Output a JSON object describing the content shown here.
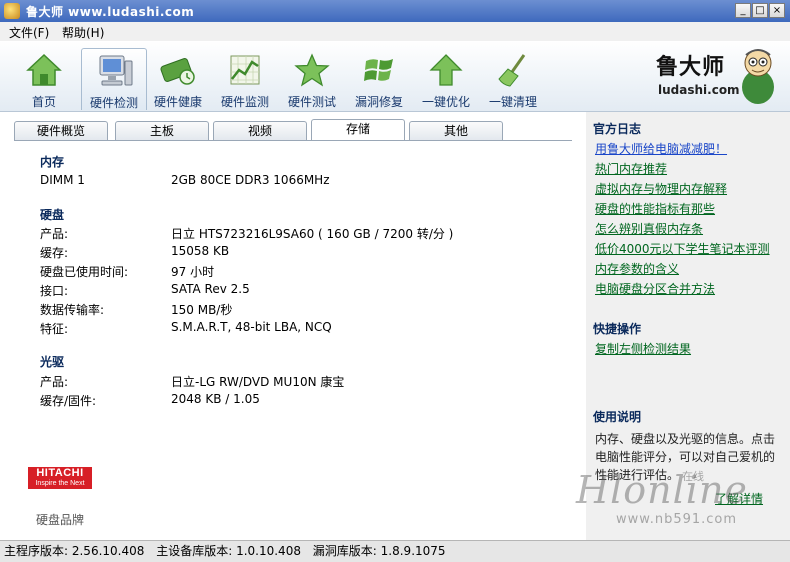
{
  "window": {
    "title": "鲁大师 www.ludashi.com",
    "minimize": "_",
    "maximize": "□",
    "close": "×"
  },
  "menu": {
    "items": [
      "文件(F)",
      "帮助(H)"
    ]
  },
  "toolbar": {
    "items": [
      {
        "label": "首页",
        "icon": "home-icon"
      },
      {
        "label": "硬件检测",
        "icon": "computer-icon",
        "active": true
      },
      {
        "label": "硬件健康",
        "icon": "health-icon"
      },
      {
        "label": "硬件监测",
        "icon": "monitor-chart-icon"
      },
      {
        "label": "硬件测试",
        "icon": "star-test-icon"
      },
      {
        "label": "漏洞修复",
        "icon": "windows-flag-icon"
      },
      {
        "label": "一键优化",
        "icon": "up-arrow-icon"
      },
      {
        "label": "一键清理",
        "icon": "broom-icon"
      }
    ],
    "brand_name": "鲁大师",
    "brand_url": "ludashi.com"
  },
  "tabs": [
    "硬件概览",
    "主板",
    "视频",
    "存储",
    "其他"
  ],
  "active_tab": "存储",
  "storage": {
    "memory": {
      "title": "内存",
      "rows": [
        {
          "label": "DIMM 1",
          "value": "2GB 80CE DDR3 1066MHz"
        }
      ]
    },
    "disk": {
      "title": "硬盘",
      "rows": [
        {
          "label": "产品:",
          "value": "日立  HTS723216L9SA60 ( 160 GB / 7200 转/分 )"
        },
        {
          "label": "缓存:",
          "value": "15058 KB"
        },
        {
          "label": "硬盘已使用时间:",
          "value": "97 小时"
        },
        {
          "label": "接口:",
          "value": "SATA Rev 2.5"
        },
        {
          "label": "数据传输率:",
          "value": "150 MB/秒"
        },
        {
          "label": "特征:",
          "value": "S.M.A.R.T,  48-bit LBA,  NCQ"
        }
      ]
    },
    "optical": {
      "title": "光驱",
      "rows": [
        {
          "label": "产品:",
          "value": "日立-LG RW/DVD MU10N 康宝"
        },
        {
          "label": "缓存/固件:",
          "value": "2048 KB / 1.05"
        }
      ]
    },
    "brand_logo_line1": "HITACHI",
    "brand_logo_line2": "Inspire the Next",
    "brand_caption": "硬盘品牌"
  },
  "sidebar": {
    "blog_title": "官方日志",
    "blog_links": [
      "用鲁大师给电脑减减肥！",
      "热门内存推荐",
      "虚拟内存与物理内存解释",
      "硬盘的性能指标有那些",
      "怎么辨别真假内存条",
      "低价4000元以下学生笔记本评测",
      "内存参数的含义",
      "电脑硬盘分区合并方法"
    ],
    "quick_title": "快捷操作",
    "quick_links": [
      "复制左侧检测结果"
    ],
    "help_title": "使用说明",
    "help_text": "内存、硬盘以及光驱的信息。点击电脑性能评分，可以对自己爱机的性能进行评估。",
    "help_link": "了解详情"
  },
  "watermark": {
    "text": "Hlonline",
    "small": "在线",
    "url": "www.nb591.com"
  },
  "statusbar": {
    "items": [
      "主程序版本: 2.56.10.408",
      "主设备库版本: 1.0.10.408",
      "漏洞库版本: 1.8.9.1075"
    ]
  }
}
